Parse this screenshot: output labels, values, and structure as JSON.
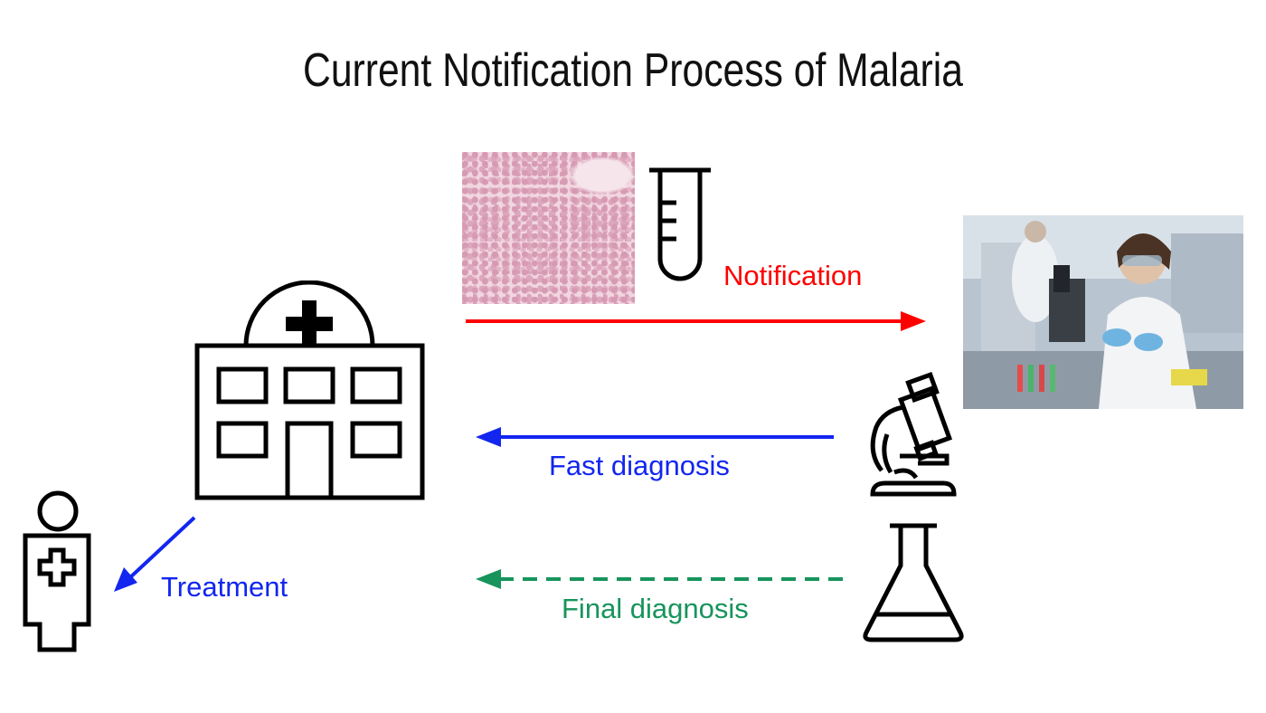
{
  "title": "Current Notification Process of Malaria",
  "labels": {
    "notification": "Notification",
    "fast_diagnosis": "Fast diagnosis",
    "final_diagnosis": "Final diagnosis",
    "treatment": "Treatment"
  },
  "colors": {
    "notification": "#ff0000",
    "fast_diagnosis": "#1226f0",
    "final_diagnosis": "#17945c",
    "treatment": "#1226f0",
    "icon_stroke": "#000000"
  },
  "icons": {
    "hospital": "hospital-icon",
    "patient": "patient-icon",
    "test_tube": "test-tube-icon",
    "microscope": "microscope-icon",
    "flask": "flask-icon",
    "blood_smear": "blood-smear-image",
    "lab_photo": "laboratory-photo"
  }
}
